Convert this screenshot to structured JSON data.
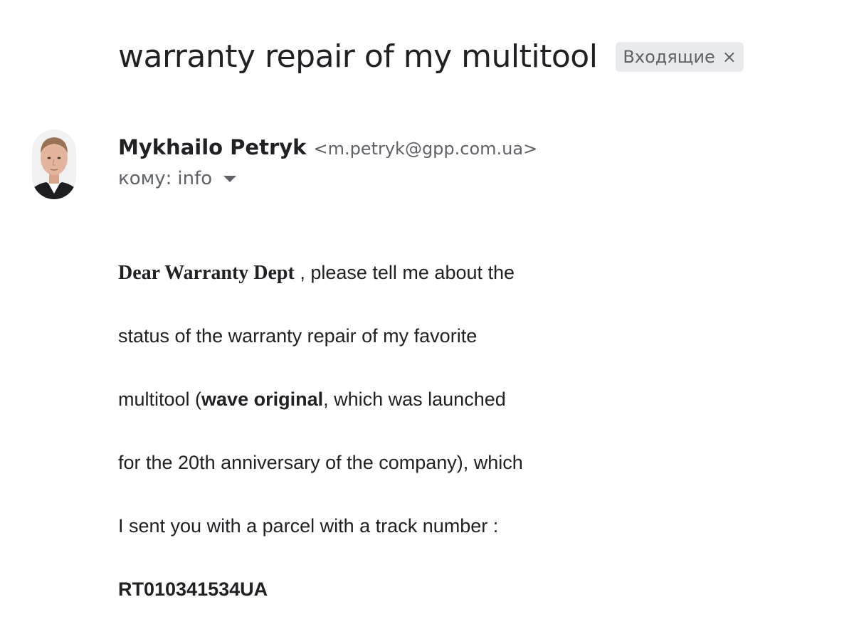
{
  "email": {
    "subject": "warranty repair of my multitool",
    "label": {
      "text": "Входящие",
      "close_glyph": "×"
    },
    "sender": {
      "name": "Mykhailo Petryk",
      "email": "<m.petryk@gpp.com.ua>",
      "avatar_icon": "avatar-photo"
    },
    "recipient": {
      "prefix": "кому:",
      "name": "info"
    },
    "body": {
      "greeting": "Dear Warranty Dept",
      "line1_rest": " , please tell me about the",
      "line2": "status of the warranty repair of my favorite",
      "line3_pre": "multitool (",
      "line3_bold": "wave original",
      "line3_post": ", which was launched",
      "line4": "for the 20th anniversary of the company), which",
      "line5": "I sent you with a parcel with a track number :",
      "track_number": "RT010341534UA"
    }
  },
  "colors": {
    "text": "#202124",
    "muted": "#5f6368",
    "chip_bg": "#e8eaed"
  }
}
